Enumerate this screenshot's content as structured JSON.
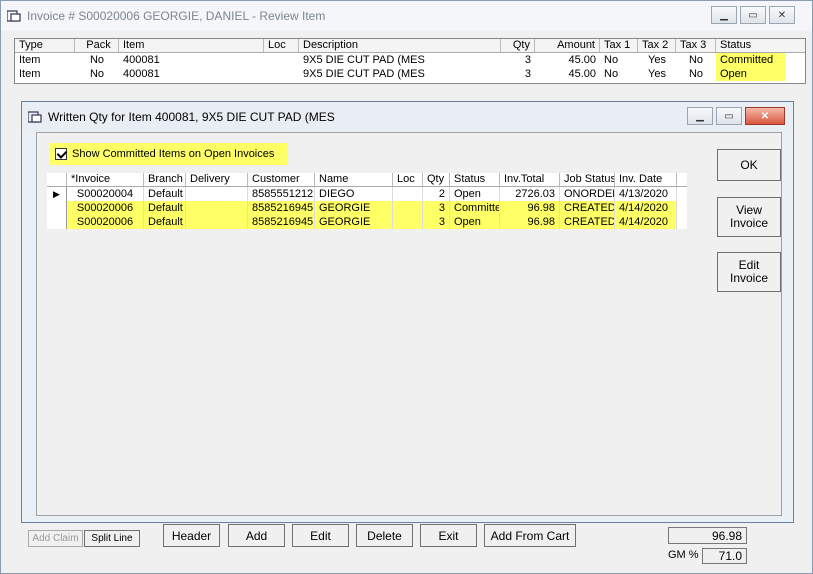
{
  "outer": {
    "title": "Invoice # S00020006   GEORGIE, DANIEL      - Review Item",
    "columns": [
      "Type",
      "Pack",
      "Item",
      "Loc",
      "Description",
      "Qty",
      "Amount",
      "Tax 1",
      "Tax 2",
      "Tax 3",
      "Status"
    ],
    "rows": [
      {
        "type": "Item",
        "pack": "No",
        "item": "400081",
        "loc": "",
        "desc": "9X5 DIE CUT PAD (MES",
        "qty": "3",
        "amount": "45.00",
        "tax1": "No",
        "tax2": "Yes",
        "tax3": "No",
        "status": "Committed"
      },
      {
        "type": "Item",
        "pack": "No",
        "item": "400081",
        "loc": "",
        "desc": "9X5 DIE CUT PAD (MES",
        "qty": "3",
        "amount": "45.00",
        "tax1": "No",
        "tax2": "Yes",
        "tax3": "No",
        "status": "Open"
      }
    ],
    "buttons": {
      "add_claim": "Add Claim",
      "split_line": "Split Line",
      "header": "Header",
      "add": "Add",
      "edit": "Edit",
      "delete": "Delete",
      "exit": "Exit",
      "add_from_cart": "Add From Cart"
    },
    "total_value": "96.98",
    "gm_label": "GM %",
    "gm_value": "71.0"
  },
  "dialog": {
    "title": "Written Qty for Item 400081, 9X5 DIE CUT PAD (MES",
    "checkbox_label": "Show Committed Items on Open Invoices",
    "columns": [
      "*Invoice",
      "Branch",
      "Delivery",
      "Customer",
      "Name",
      "Loc",
      "Qty",
      "Status",
      "Inv.Total",
      "Job Status",
      "Inv. Date"
    ],
    "rows": [
      {
        "invoice": "S00020004",
        "branch": "Default",
        "delivery": "",
        "customer": "8585551212",
        "name": "DIEGO",
        "loc": "",
        "qty": "2",
        "status": "Open",
        "total": "2726.03",
        "job": "ONORDEF",
        "date": "4/13/2020"
      },
      {
        "invoice": "S00020006",
        "branch": "Default",
        "delivery": "",
        "customer": "8585216945",
        "name": "GEORGIE",
        "loc": "",
        "qty": "3",
        "status": "Committed",
        "total": "96.98",
        "job": "CREATED",
        "date": "4/14/2020"
      },
      {
        "invoice": "S00020006",
        "branch": "Default",
        "delivery": "",
        "customer": "8585216945",
        "name": "GEORGIE",
        "loc": "",
        "qty": "3",
        "status": "Open",
        "total": "96.98",
        "job": "CREATED",
        "date": "4/14/2020"
      }
    ],
    "buttons": {
      "ok": "OK",
      "view_invoice_1": "View",
      "view_invoice_2": "Invoice",
      "edit_invoice": "Edit Invoice"
    }
  },
  "colors": {
    "highlight": "#ffff66"
  }
}
